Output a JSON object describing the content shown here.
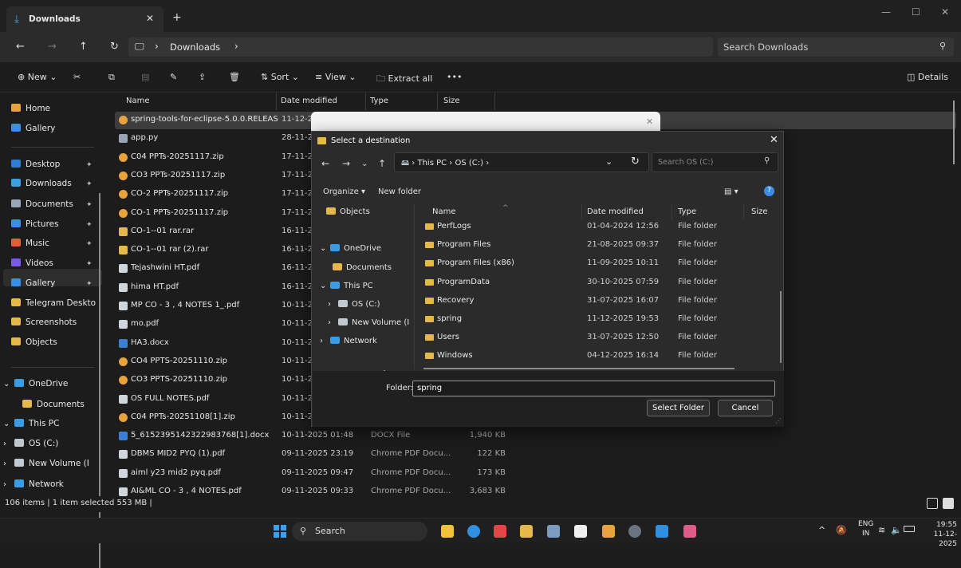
{
  "window": {
    "tab_title": "Downloads",
    "tab_close": "✕",
    "new_tab": "+",
    "controls": [
      "—",
      "☐",
      "✕"
    ]
  },
  "nav": {
    "breadcrumb": [
      "Downloads"
    ],
    "search_placeholder": "Search Downloads"
  },
  "commands": {
    "new": "New",
    "sort": "Sort",
    "view": "View",
    "extract_all": "Extract all",
    "more": "•••",
    "details": "Details"
  },
  "sidebar": {
    "top": [
      {
        "label": "Home",
        "icon": "home-icon",
        "color": "#e8a33c"
      },
      {
        "label": "Gallery",
        "icon": "gallery-icon",
        "color": "#3a8ee6"
      }
    ],
    "pinned": [
      {
        "label": "Desktop",
        "icon": "desktop-icon",
        "color": "#2f7dd1"
      },
      {
        "label": "Downloads",
        "icon": "downloads-icon",
        "color": "#3aa0e0"
      },
      {
        "label": "Documents",
        "icon": "documents-icon",
        "color": "#9aa6b8"
      },
      {
        "label": "Pictures",
        "icon": "pictures-icon",
        "color": "#3a8ee6"
      },
      {
        "label": "Music",
        "icon": "music-icon",
        "color": "#e0603a"
      },
      {
        "label": "Videos",
        "icon": "videos-icon",
        "color": "#7a5ae0"
      },
      {
        "label": "Gallery",
        "icon": "gallery-icon",
        "color": "#3a8ee6"
      },
      {
        "label": "Telegram Deskto",
        "icon": "folder-icon",
        "color": "#e6b84a"
      },
      {
        "label": "Screenshots",
        "icon": "folder-icon",
        "color": "#e6b84a"
      },
      {
        "label": "Objects",
        "icon": "folder-icon",
        "color": "#e6b84a"
      }
    ],
    "tree": [
      {
        "label": "OneDrive",
        "icon": "onedrive-icon",
        "color": "#3a9be6",
        "chev": "⌄"
      },
      {
        "label": "Documents",
        "icon": "folder-icon",
        "color": "#e6b84a",
        "chev": ""
      },
      {
        "label": "This PC",
        "icon": "pc-icon",
        "color": "#3a9be6",
        "chev": "⌄"
      },
      {
        "label": "OS (C:)",
        "icon": "drive-icon",
        "color": "#c0c8d0",
        "chev": "›"
      },
      {
        "label": "New Volume (I",
        "icon": "drive-icon",
        "color": "#c0c8d0",
        "chev": "›"
      },
      {
        "label": "Network",
        "icon": "network-icon",
        "color": "#3a9be6",
        "chev": "›"
      }
    ]
  },
  "columns": {
    "name": "Name",
    "date": "Date modified",
    "type": "Type",
    "size": "Size"
  },
  "files": [
    {
      "name": "spring-tools-for-eclipse-5.0.0.RELEASE-e...",
      "date": "11-12-2",
      "type": "",
      "size": "",
      "icon": "chrome",
      "selected": true
    },
    {
      "name": "app.py",
      "date": "28-11-2",
      "type": "",
      "size": "",
      "icon": "doc"
    },
    {
      "name": "C04 PPTs-20251117.zip",
      "date": "17-11-2",
      "type": "",
      "size": "",
      "icon": "chrome"
    },
    {
      "name": "CO3 PPTs-20251117.zip",
      "date": "17-11-2",
      "type": "",
      "size": "",
      "icon": "chrome"
    },
    {
      "name": "CO-2 PPTs-20251117.zip",
      "date": "17-11-2",
      "type": "",
      "size": "",
      "icon": "chrome"
    },
    {
      "name": "CO-1 PPTs-20251117.zip",
      "date": "17-11-2",
      "type": "",
      "size": "",
      "icon": "chrome"
    },
    {
      "name": "CO-1--01 rar.rar",
      "date": "16-11-2",
      "type": "",
      "size": "",
      "icon": "folder"
    },
    {
      "name": "CO-1--01 rar (2).rar",
      "date": "16-11-2",
      "type": "",
      "size": "",
      "icon": "folder"
    },
    {
      "name": "Tejashwini HT.pdf",
      "date": "16-11-2",
      "type": "",
      "size": "",
      "icon": "pdf"
    },
    {
      "name": "hima HT.pdf",
      "date": "16-11-2",
      "type": "",
      "size": "",
      "icon": "pdf"
    },
    {
      "name": "MP CO - 3 , 4 NOTES 1_.pdf",
      "date": "10-11-2",
      "type": "",
      "size": "",
      "icon": "pdf"
    },
    {
      "name": "mo.pdf",
      "date": "10-11-2",
      "type": "",
      "size": "",
      "icon": "pdf"
    },
    {
      "name": "HA3.docx",
      "date": "10-11-2",
      "type": "",
      "size": "",
      "icon": "docx"
    },
    {
      "name": "CO4 PPTS-20251110.zip",
      "date": "10-11-2",
      "type": "",
      "size": "",
      "icon": "chrome"
    },
    {
      "name": "CO3 PPTS-20251110.zip",
      "date": "10-11-2",
      "type": "",
      "size": "",
      "icon": "chrome"
    },
    {
      "name": "OS FULL NOTES.pdf",
      "date": "10-11-2",
      "type": "",
      "size": "",
      "icon": "pdf"
    },
    {
      "name": "C04 PPTs-20251108[1].zip",
      "date": "10-11-20",
      "type": "",
      "size": "",
      "icon": "chrome"
    },
    {
      "name": "5_6152395142322983768[1].docx",
      "date": "10-11-2025 01:48",
      "type": "DOCX File",
      "size": "1,940 KB",
      "icon": "docx"
    },
    {
      "name": "DBMS MID2 PYQ (1).pdf",
      "date": "09-11-2025 23:19",
      "type": "Chrome PDF Docu...",
      "size": "122 KB",
      "icon": "pdf"
    },
    {
      "name": "aiml y23 mid2 pyq.pdf",
      "date": "09-11-2025 09:47",
      "type": "Chrome PDF Docu...",
      "size": "173 KB",
      "icon": "pdf"
    },
    {
      "name": "AI&ML CO - 3 , 4 NOTES.pdf",
      "date": "09-11-2025 09:33",
      "type": "Chrome PDF Docu...",
      "size": "3,683 KB",
      "icon": "pdf"
    }
  ],
  "status": "106 items  |  1 item selected  553 MB  |",
  "dialog": {
    "title": "Select a destination",
    "path": "›  This PC  ›  OS (C:)  ›",
    "search_placeholder": "Search OS (C:)",
    "organize": "Organize ▾",
    "new_folder": "New folder",
    "tree": [
      {
        "label": "Objects",
        "color": "#e6b84a",
        "chev": "",
        "indent": 16
      },
      {
        "label": "",
        "color": "",
        "chev": "",
        "indent": 0
      },
      {
        "label": "OneDrive",
        "color": "#3a9be6",
        "chev": "⌄",
        "indent": 8
      },
      {
        "label": "Documents",
        "color": "#e6b84a",
        "chev": "",
        "indent": 24
      },
      {
        "label": "This PC",
        "color": "#3a9be6",
        "chev": "⌄",
        "indent": 8
      },
      {
        "label": "OS (C:)",
        "color": "#c0c8d0",
        "chev": "›",
        "indent": 18
      },
      {
        "label": "New Volume (I",
        "color": "#c0c8d0",
        "chev": "›",
        "indent": 18
      },
      {
        "label": "Network",
        "color": "#3a9be6",
        "chev": "›",
        "indent": 8
      }
    ],
    "columns": {
      "name": "Name",
      "date": "Date modified",
      "type": "Type",
      "size": "Size"
    },
    "folders": [
      {
        "name": "PerfLogs",
        "date": "01-04-2024 12:56",
        "type": "File folder"
      },
      {
        "name": "Program Files",
        "date": "21-08-2025 09:37",
        "type": "File folder"
      },
      {
        "name": "Program Files (x86)",
        "date": "11-09-2025 10:11",
        "type": "File folder"
      },
      {
        "name": "ProgramData",
        "date": "30-10-2025 07:59",
        "type": "File folder"
      },
      {
        "name": "Recovery",
        "date": "31-07-2025 16:07",
        "type": "File folder"
      },
      {
        "name": "spring",
        "date": "11-12-2025 19:53",
        "type": "File folder"
      },
      {
        "name": "Users",
        "date": "31-07-2025 12:50",
        "type": "File folder"
      },
      {
        "name": "Windows",
        "date": "04-12-2025 16:14",
        "type": "File folder"
      }
    ],
    "folder_label": "Folder:",
    "folder_value": "spring",
    "select_button": "Select Folder",
    "cancel_button": "Cancel"
  },
  "taskbar": {
    "search_label": "Search",
    "lang": "ENG",
    "region": "IN",
    "time": "19:55",
    "date": "11-12-2025",
    "apps": [
      "#f0c13a",
      "#2f8fe0",
      "#e04848",
      "#e6b84a",
      "#7a9cc0",
      "#f0f0f0",
      "#e8a33c",
      "#6a7480",
      "#2f8fe0",
      "#e05a8a"
    ]
  }
}
